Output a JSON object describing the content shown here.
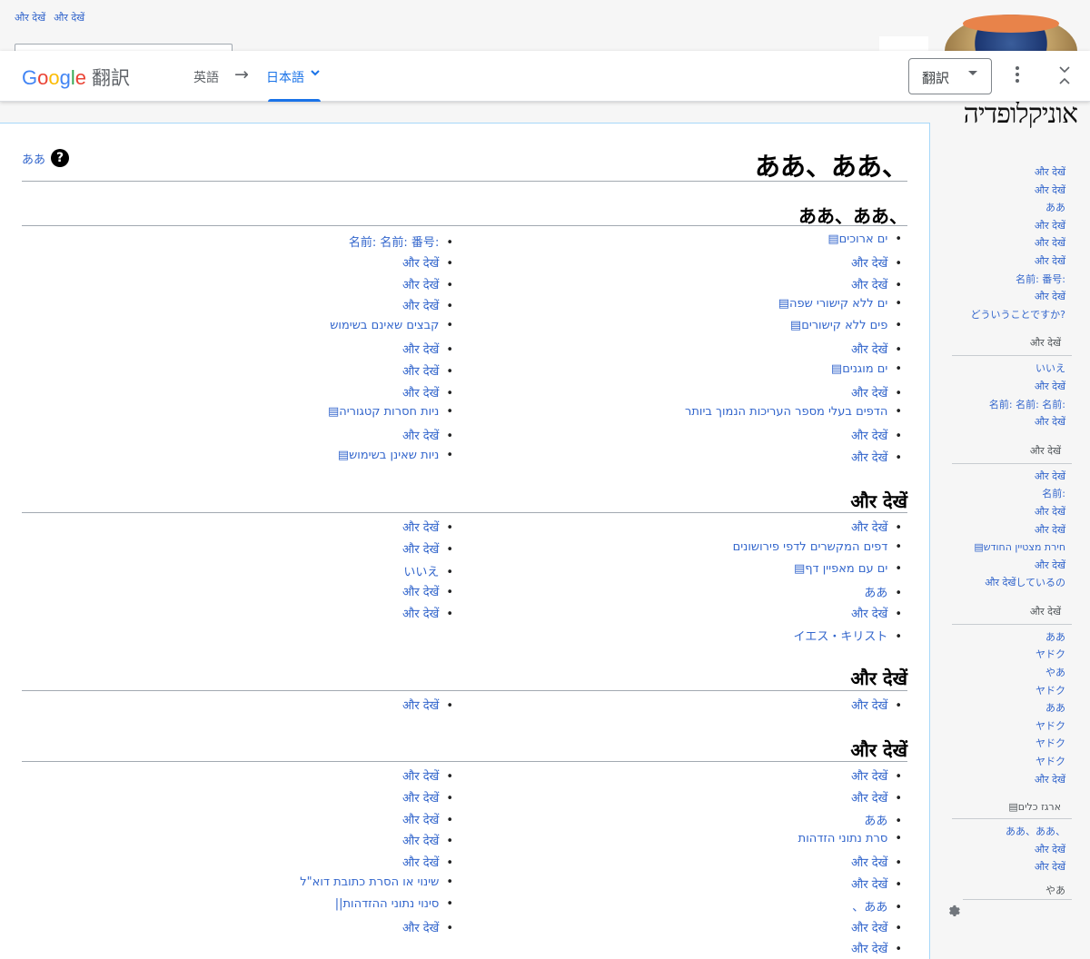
{
  "personal_links": [
    "और देखें",
    "और देखें"
  ],
  "translate_bar": {
    "logo_google": [
      "G",
      "o",
      "o",
      "g",
      "l",
      "e"
    ],
    "logo_suffix": "翻訳",
    "source_lang": "英語",
    "arrow": "→",
    "target_lang": "日本語",
    "target_chevron": "⌄",
    "translate_button": "翻訳",
    "more_icon": "⋮",
    "close_icon": "⌃⌄"
  },
  "logo_text": "אוניקלופדיה",
  "help_link": "ああ",
  "help_icon": "?",
  "first_heading": "、ああ、ああ",
  "sections": [
    {
      "heading": "、ああ、ああ",
      "right": [
        "ים ארוכים▤",
        "और देखें",
        "और देखें",
        "ים ללא קישורי שפה▤",
        "פים ללא קישורים▤",
        "और देखें",
        "ים מוגנים▤",
        "और देखें",
        "הדפים בעלי מספר העריכות הנמוך ביותר",
        "और देखें",
        "और देखें"
      ],
      "left": [
        ":名前: 名前: 番号",
        "और देखें",
        "और देखें",
        "और देखें",
        "קבצים שאינם בשימוש",
        "और देखें",
        "और देखें",
        "और देखें",
        "ניות חסרות קטגוריה▤",
        "और देखें",
        "ניות שאינן בשימוש▤"
      ]
    },
    {
      "heading": "और देखें",
      "right": [
        "और देखें",
        "דפים המקשרים לדפי פירושונים",
        "ים עם מאפיין דף▤",
        "ああ",
        "और देखें",
        "イエス・キリスト"
      ],
      "left": [
        "और देखें",
        "और देखें",
        "いいえ",
        "और देखें",
        "और देखें"
      ]
    },
    {
      "heading": "और देखें",
      "right": [
        "और देखें"
      ],
      "left": [
        "और देखें"
      ]
    },
    {
      "heading": "और देखें",
      "right": [
        "और देखें",
        "और देखें",
        "ああ",
        "סרת נתוני הזדהות",
        "और देखें",
        "और देखें",
        "ああ、",
        "और देखें",
        "और देखें"
      ],
      "left": [
        "और देखें",
        "और देखें",
        "और देखें",
        "और देखें",
        "और देखें",
        "שינוי או הסרת כתובת דוא\"ל",
        "סינוי נתוני ההזדהות||",
        "और देखें"
      ]
    }
  ],
  "sidebar": {
    "top": [
      "और देखें",
      "और देखें",
      "ああ",
      "और देखें",
      "और देखें",
      "और देखें",
      ":名前: 番号",
      "और देखें",
      "?どういうことですか"
    ],
    "groups": [
      {
        "head": "और देखें",
        "items": [
          "いいえ",
          "और देखें",
          ":名前: 名前: 名前",
          "और देखें"
        ]
      },
      {
        "head": "और देखें",
        "items": [
          "और देखें",
          ":名前",
          "और देखें",
          "और देखें",
          "חירת מצטיין החודש▤",
          "और देखें",
          "और देखेंしているの"
        ]
      },
      {
        "head": "और देखें",
        "items": [
          "ああ",
          "ヤドク",
          "やあ",
          "ヤドク",
          "ああ",
          "ヤドク",
          "ヤドク",
          "ヤドク",
          "और देखें"
        ]
      },
      {
        "head": "ארגז כלים▤",
        "items": [
          "、ああ、ああ",
          "और देखें",
          "और देखें"
        ]
      }
    ],
    "last_item": "やあ",
    "gear_icon": "⚙"
  }
}
